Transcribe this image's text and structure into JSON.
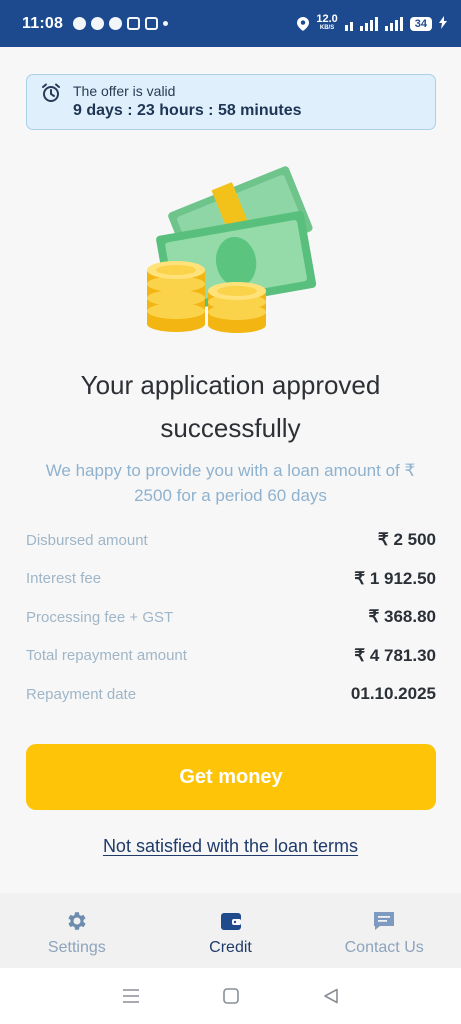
{
  "status_bar": {
    "time": "11:08",
    "speed_value": "12.0",
    "speed_unit": "KB/S",
    "battery": "34"
  },
  "offer": {
    "label": "The offer is valid",
    "countdown": "9 days : 23 hours : 58 minutes"
  },
  "headline": "Your application approved successfully",
  "subtext": "We happy to provide you with a loan amount of ₹ 2500 for a period 60 days",
  "details": [
    {
      "label": "Disbursed amount",
      "value": "₹ 2 500"
    },
    {
      "label": "Interest fee",
      "value": "₹ 1 912.50"
    },
    {
      "label": "Processing fee + GST",
      "value": "₹ 368.80"
    },
    {
      "label": "Total repayment amount",
      "value": "₹ 4 781.30"
    },
    {
      "label": "Repayment date",
      "value": "01.10.2025"
    }
  ],
  "cta": {
    "get_money": "Get money",
    "not_satisfied": "Not satisfied with the loan terms"
  },
  "bottom_nav": [
    {
      "label": "Settings",
      "icon": "gear-icon"
    },
    {
      "label": "Credit",
      "icon": "wallet-icon",
      "active": true
    },
    {
      "label": "Contact Us",
      "icon": "chat-icon"
    }
  ],
  "colors": {
    "header": "#1d4a8f",
    "accent": "#fec407",
    "nav_active": "#1f3a6b",
    "nav_inactive": "#8da4bd"
  }
}
